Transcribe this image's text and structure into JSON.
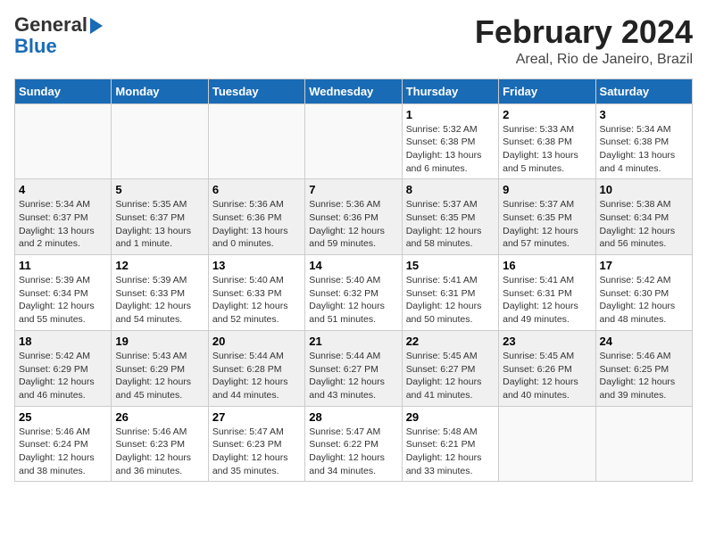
{
  "header": {
    "logo_line1": "General",
    "logo_line2": "Blue",
    "title": "February 2024",
    "subtitle": "Areal, Rio de Janeiro, Brazil"
  },
  "days_of_week": [
    "Sunday",
    "Monday",
    "Tuesday",
    "Wednesday",
    "Thursday",
    "Friday",
    "Saturday"
  ],
  "weeks": [
    [
      {
        "day": "",
        "sunrise": "",
        "sunset": "",
        "daylight": ""
      },
      {
        "day": "",
        "sunrise": "",
        "sunset": "",
        "daylight": ""
      },
      {
        "day": "",
        "sunrise": "",
        "sunset": "",
        "daylight": ""
      },
      {
        "day": "",
        "sunrise": "",
        "sunset": "",
        "daylight": ""
      },
      {
        "day": "1",
        "sunrise": "Sunrise: 5:32 AM",
        "sunset": "Sunset: 6:38 PM",
        "daylight": "Daylight: 13 hours and 6 minutes."
      },
      {
        "day": "2",
        "sunrise": "Sunrise: 5:33 AM",
        "sunset": "Sunset: 6:38 PM",
        "daylight": "Daylight: 13 hours and 5 minutes."
      },
      {
        "day": "3",
        "sunrise": "Sunrise: 5:34 AM",
        "sunset": "Sunset: 6:38 PM",
        "daylight": "Daylight: 13 hours and 4 minutes."
      }
    ],
    [
      {
        "day": "4",
        "sunrise": "Sunrise: 5:34 AM",
        "sunset": "Sunset: 6:37 PM",
        "daylight": "Daylight: 13 hours and 2 minutes."
      },
      {
        "day": "5",
        "sunrise": "Sunrise: 5:35 AM",
        "sunset": "Sunset: 6:37 PM",
        "daylight": "Daylight: 13 hours and 1 minute."
      },
      {
        "day": "6",
        "sunrise": "Sunrise: 5:36 AM",
        "sunset": "Sunset: 6:36 PM",
        "daylight": "Daylight: 13 hours and 0 minutes."
      },
      {
        "day": "7",
        "sunrise": "Sunrise: 5:36 AM",
        "sunset": "Sunset: 6:36 PM",
        "daylight": "Daylight: 12 hours and 59 minutes."
      },
      {
        "day": "8",
        "sunrise": "Sunrise: 5:37 AM",
        "sunset": "Sunset: 6:35 PM",
        "daylight": "Daylight: 12 hours and 58 minutes."
      },
      {
        "day": "9",
        "sunrise": "Sunrise: 5:37 AM",
        "sunset": "Sunset: 6:35 PM",
        "daylight": "Daylight: 12 hours and 57 minutes."
      },
      {
        "day": "10",
        "sunrise": "Sunrise: 5:38 AM",
        "sunset": "Sunset: 6:34 PM",
        "daylight": "Daylight: 12 hours and 56 minutes."
      }
    ],
    [
      {
        "day": "11",
        "sunrise": "Sunrise: 5:39 AM",
        "sunset": "Sunset: 6:34 PM",
        "daylight": "Daylight: 12 hours and 55 minutes."
      },
      {
        "day": "12",
        "sunrise": "Sunrise: 5:39 AM",
        "sunset": "Sunset: 6:33 PM",
        "daylight": "Daylight: 12 hours and 54 minutes."
      },
      {
        "day": "13",
        "sunrise": "Sunrise: 5:40 AM",
        "sunset": "Sunset: 6:33 PM",
        "daylight": "Daylight: 12 hours and 52 minutes."
      },
      {
        "day": "14",
        "sunrise": "Sunrise: 5:40 AM",
        "sunset": "Sunset: 6:32 PM",
        "daylight": "Daylight: 12 hours and 51 minutes."
      },
      {
        "day": "15",
        "sunrise": "Sunrise: 5:41 AM",
        "sunset": "Sunset: 6:31 PM",
        "daylight": "Daylight: 12 hours and 50 minutes."
      },
      {
        "day": "16",
        "sunrise": "Sunrise: 5:41 AM",
        "sunset": "Sunset: 6:31 PM",
        "daylight": "Daylight: 12 hours and 49 minutes."
      },
      {
        "day": "17",
        "sunrise": "Sunrise: 5:42 AM",
        "sunset": "Sunset: 6:30 PM",
        "daylight": "Daylight: 12 hours and 48 minutes."
      }
    ],
    [
      {
        "day": "18",
        "sunrise": "Sunrise: 5:42 AM",
        "sunset": "Sunset: 6:29 PM",
        "daylight": "Daylight: 12 hours and 46 minutes."
      },
      {
        "day": "19",
        "sunrise": "Sunrise: 5:43 AM",
        "sunset": "Sunset: 6:29 PM",
        "daylight": "Daylight: 12 hours and 45 minutes."
      },
      {
        "day": "20",
        "sunrise": "Sunrise: 5:44 AM",
        "sunset": "Sunset: 6:28 PM",
        "daylight": "Daylight: 12 hours and 44 minutes."
      },
      {
        "day": "21",
        "sunrise": "Sunrise: 5:44 AM",
        "sunset": "Sunset: 6:27 PM",
        "daylight": "Daylight: 12 hours and 43 minutes."
      },
      {
        "day": "22",
        "sunrise": "Sunrise: 5:45 AM",
        "sunset": "Sunset: 6:27 PM",
        "daylight": "Daylight: 12 hours and 41 minutes."
      },
      {
        "day": "23",
        "sunrise": "Sunrise: 5:45 AM",
        "sunset": "Sunset: 6:26 PM",
        "daylight": "Daylight: 12 hours and 40 minutes."
      },
      {
        "day": "24",
        "sunrise": "Sunrise: 5:46 AM",
        "sunset": "Sunset: 6:25 PM",
        "daylight": "Daylight: 12 hours and 39 minutes."
      }
    ],
    [
      {
        "day": "25",
        "sunrise": "Sunrise: 5:46 AM",
        "sunset": "Sunset: 6:24 PM",
        "daylight": "Daylight: 12 hours and 38 minutes."
      },
      {
        "day": "26",
        "sunrise": "Sunrise: 5:46 AM",
        "sunset": "Sunset: 6:23 PM",
        "daylight": "Daylight: 12 hours and 36 minutes."
      },
      {
        "day": "27",
        "sunrise": "Sunrise: 5:47 AM",
        "sunset": "Sunset: 6:23 PM",
        "daylight": "Daylight: 12 hours and 35 minutes."
      },
      {
        "day": "28",
        "sunrise": "Sunrise: 5:47 AM",
        "sunset": "Sunset: 6:22 PM",
        "daylight": "Daylight: 12 hours and 34 minutes."
      },
      {
        "day": "29",
        "sunrise": "Sunrise: 5:48 AM",
        "sunset": "Sunset: 6:21 PM",
        "daylight": "Daylight: 12 hours and 33 minutes."
      },
      {
        "day": "",
        "sunrise": "",
        "sunset": "",
        "daylight": ""
      },
      {
        "day": "",
        "sunrise": "",
        "sunset": "",
        "daylight": ""
      }
    ]
  ],
  "row_shading": [
    "white",
    "shade",
    "white",
    "shade",
    "white"
  ]
}
